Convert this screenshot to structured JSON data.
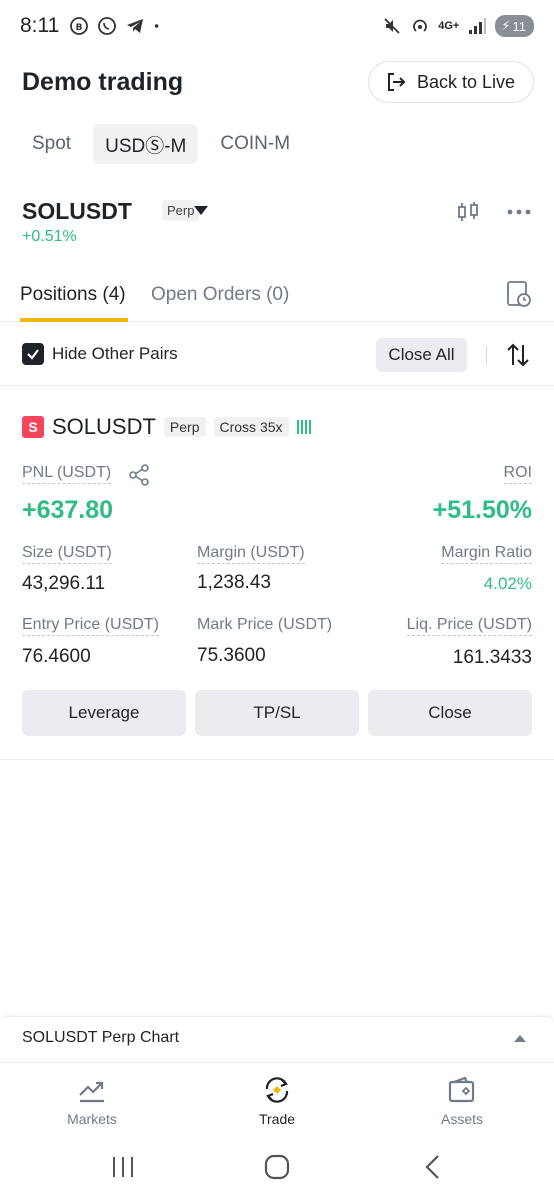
{
  "status_bar": {
    "time": "8:11",
    "battery": "11",
    "network": "4G+"
  },
  "header": {
    "title": "Demo trading",
    "back_live_label": "Back to Live"
  },
  "mode_tabs": [
    {
      "label": "Spot"
    },
    {
      "label": "USDⓈ-M"
    },
    {
      "label": "COIN-M"
    }
  ],
  "symbol": {
    "name": "SOLUSDT",
    "badge": "Perp",
    "change": "+0.51%"
  },
  "position_tabs": [
    {
      "label": "Positions (4)"
    },
    {
      "label": "Open Orders (0)"
    }
  ],
  "filter": {
    "hide_label": "Hide Other Pairs",
    "close_all_label": "Close All",
    "hide_checked": true
  },
  "position": {
    "side_badge": "S",
    "symbol": "SOLUSDT",
    "type_tag": "Perp",
    "margin_tag": "Cross 35x",
    "pnl_label": "PNL (USDT)",
    "pnl_value": "+637.80",
    "roi_label": "ROI",
    "roi_value": "+51.50%",
    "size_label": "Size (USDT)",
    "size_value": "43,296.11",
    "margin_label": "Margin (USDT)",
    "margin_value": "1,238.43",
    "margin_ratio_label": "Margin Ratio",
    "margin_ratio_value": "4.02%",
    "entry_label": "Entry Price (USDT)",
    "entry_value": "76.4600",
    "mark_label": "Mark Price (USDT)",
    "mark_value": "75.3600",
    "liq_label": "Liq. Price (USDT)",
    "liq_value": "161.3433",
    "buttons": {
      "leverage": "Leverage",
      "tpsl": "TP/SL",
      "close": "Close"
    }
  },
  "chart_bar": {
    "label": "SOLUSDT Perp Chart"
  },
  "bottom_nav": [
    {
      "label": "Markets",
      "icon": "trend-chart-icon"
    },
    {
      "label": "Trade",
      "icon": "trade-swap-icon"
    },
    {
      "label": "Assets",
      "icon": "wallet-icon"
    }
  ],
  "colors": {
    "positive": "#2ebd85",
    "negative": "#f6465d",
    "accent": "#f0b90b",
    "text": "#1e2329",
    "muted": "#707a8a"
  }
}
